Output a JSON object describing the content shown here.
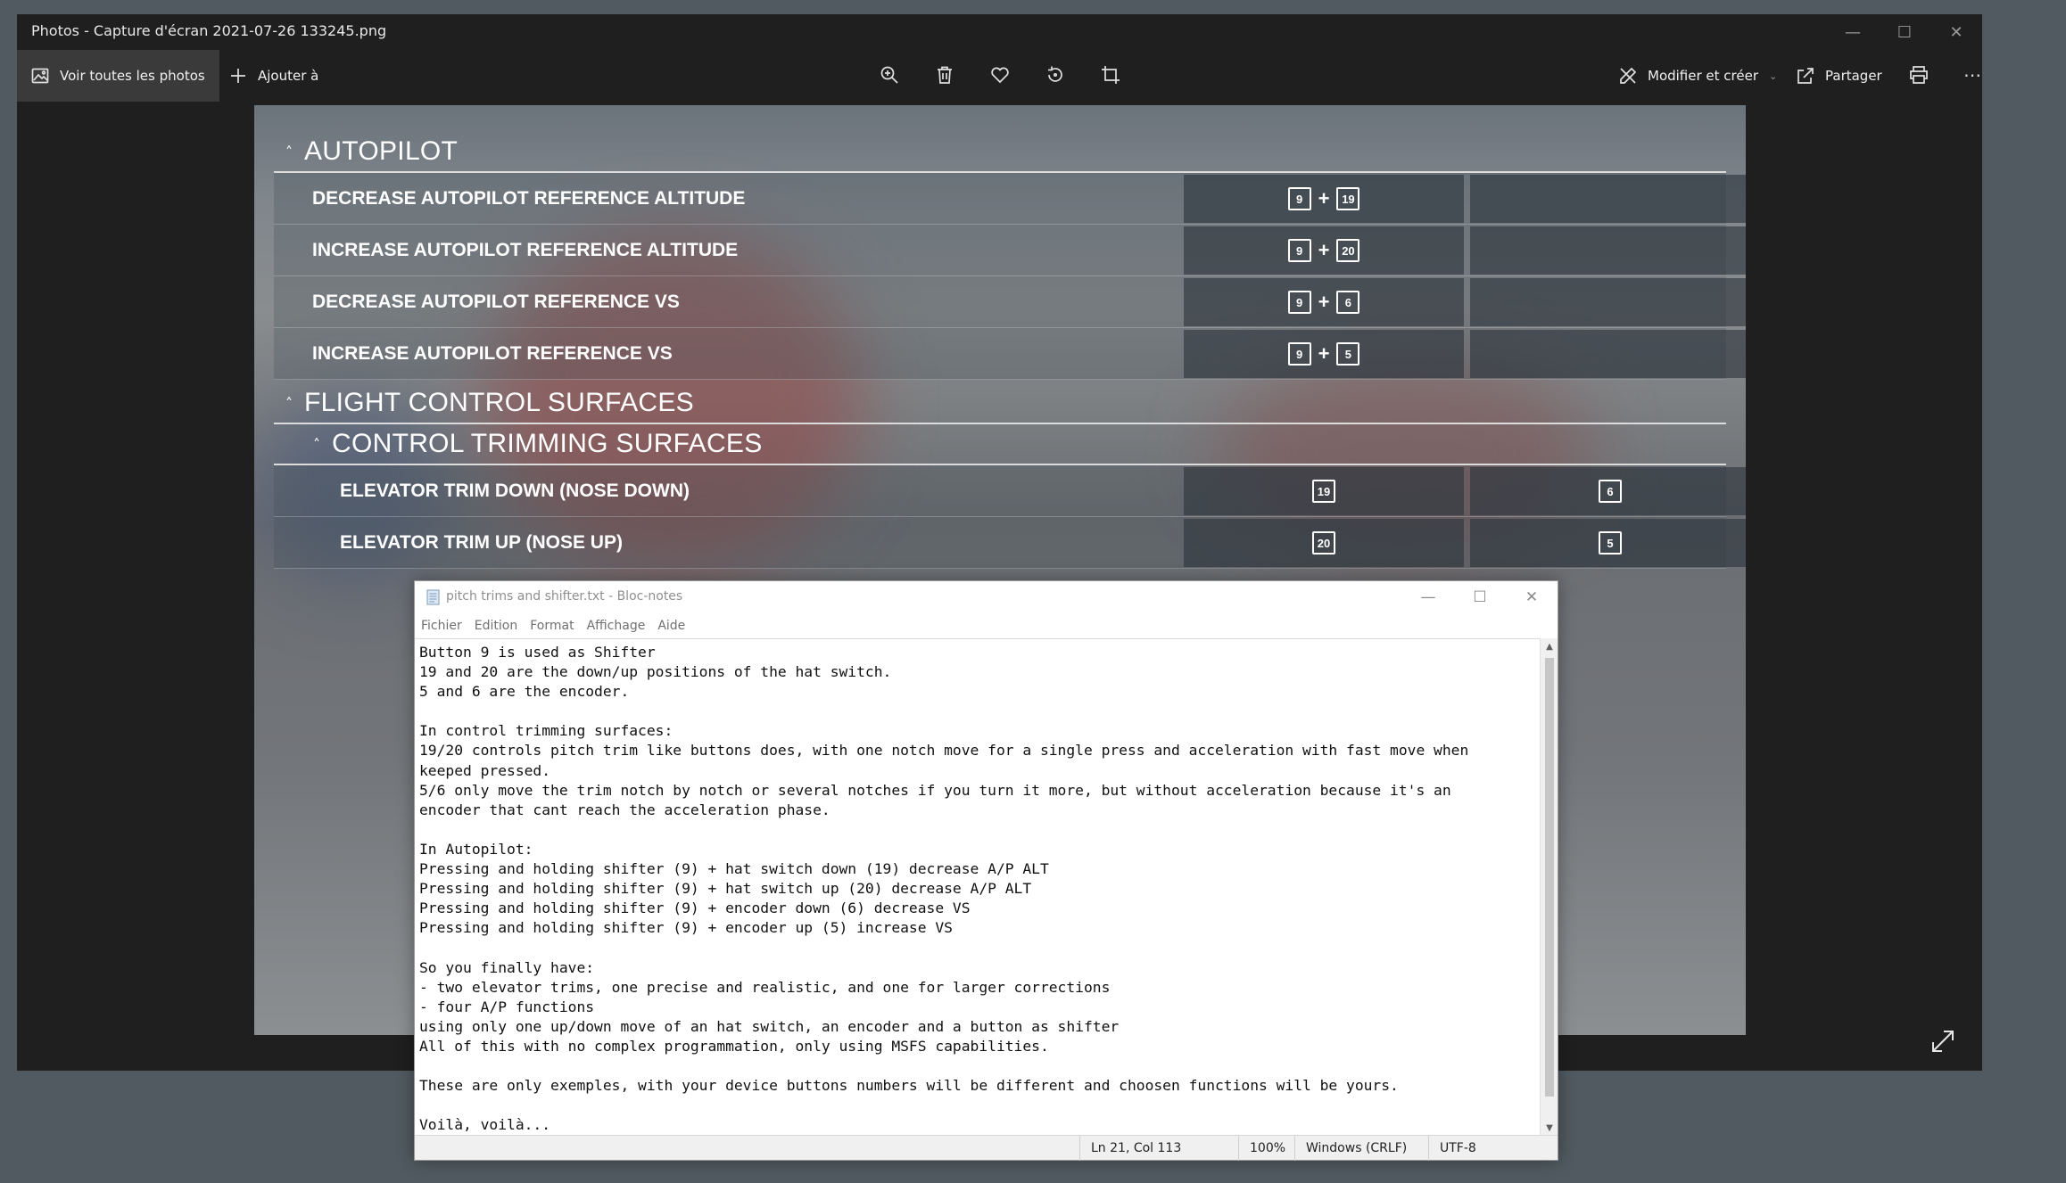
{
  "photos": {
    "title": "Photos - Capture d'écran 2021-07-26 133245.png",
    "toolbar": {
      "see_all": "Voir toutes les photos",
      "add_to": "Ajouter à",
      "edit_create": "Modifier et créer",
      "share": "Partager"
    }
  },
  "screenshot": {
    "autopilot": {
      "header": "AUTOPILOT",
      "rows": [
        {
          "label": "DECREASE AUTOPILOT REFERENCE ALTITUDE",
          "k1": "9",
          "k2": "19"
        },
        {
          "label": "INCREASE AUTOPILOT REFERENCE ALTITUDE",
          "k1": "9",
          "k2": "20"
        },
        {
          "label": "DECREASE AUTOPILOT REFERENCE VS",
          "k1": "9",
          "k2": "6"
        },
        {
          "label": "INCREASE AUTOPILOT REFERENCE VS",
          "k1": "9",
          "k2": "5"
        }
      ]
    },
    "flight": {
      "header": "FLIGHT CONTROL SURFACES",
      "sub_header": "CONTROL TRIMMING SURFACES",
      "rows": [
        {
          "label": "ELEVATOR TRIM DOWN (NOSE DOWN)",
          "primary": "19",
          "secondary": "6"
        },
        {
          "label": "ELEVATOR TRIM UP (NOSE UP)",
          "primary": "20",
          "secondary": "5"
        }
      ]
    },
    "plus": "+"
  },
  "notepad": {
    "title": "pitch trims and shifter.txt - Bloc-notes",
    "menu": [
      "Fichier",
      "Edition",
      "Format",
      "Affichage",
      "Aide"
    ],
    "content": "Button 9 is used as Shifter\n19 and 20 are the down/up positions of the hat switch.\n5 and 6 are the encoder.\n\nIn control trimming surfaces:\n19/20 controls pitch trim like buttons does, with one notch move for a single press and acceleration with fast move when\nkeeped pressed.\n5/6 only move the trim notch by notch or several notches if you turn it more, but without acceleration because it's an\nencoder that cant reach the acceleration phase.\n\nIn Autopilot:\nPressing and holding shifter (9) + hat switch down (19) decrease A/P ALT\nPressing and holding shifter (9) + hat switch up (20) decrease A/P ALT\nPressing and holding shifter (9) + encoder down (6) decrease VS\nPressing and holding shifter (9) + encoder up (5) increase VS\n\nSo you finally have:\n- two elevator trims, one precise and realistic, and one for larger corrections\n- four A/P functions\nusing only one up/down move of an hat switch, an encoder and a button as shifter\nAll of this with no complex programmation, only using MSFS capabilities.\n\nThese are only exemples, with your device buttons numbers will be different and choosen functions will be yours.\n\nVoilà, voilà...",
    "status": {
      "position": "Ln 21, Col 113",
      "zoom": "100%",
      "line_ending": "Windows (CRLF)",
      "encoding": "UTF-8"
    }
  }
}
